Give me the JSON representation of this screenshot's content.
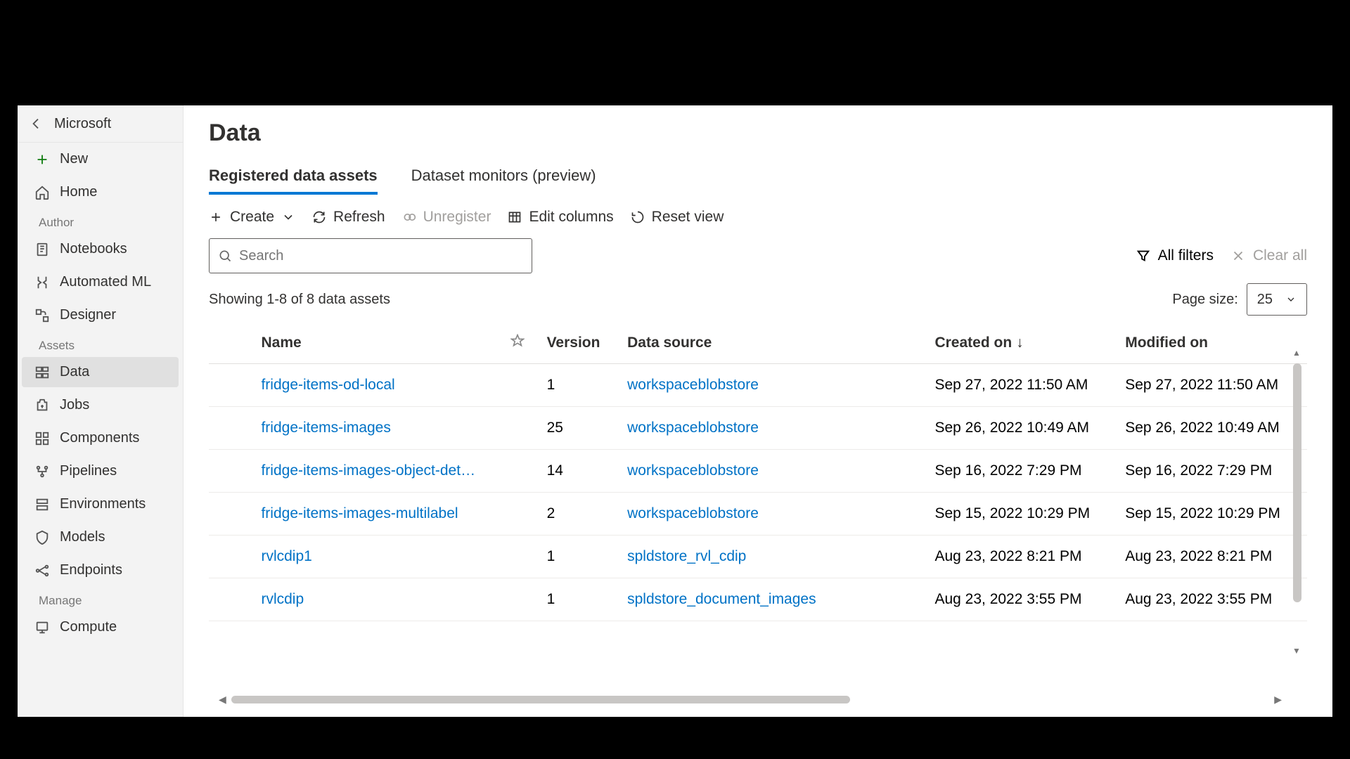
{
  "header": {
    "title": "Microsoft"
  },
  "sidebar": {
    "new_label": "New",
    "home_label": "Home",
    "groups": {
      "author": "Author",
      "assets": "Assets",
      "manage": "Manage"
    },
    "author_items": {
      "notebooks": "Notebooks",
      "automated_ml": "Automated ML",
      "designer": "Designer"
    },
    "assets_items": {
      "data": "Data",
      "jobs": "Jobs",
      "components": "Components",
      "pipelines": "Pipelines",
      "environments": "Environments",
      "models": "Models",
      "endpoints": "Endpoints"
    },
    "manage_items": {
      "compute": "Compute"
    }
  },
  "page": {
    "title": "Data",
    "tabs": {
      "registered": "Registered data assets",
      "monitors": "Dataset monitors (preview)"
    },
    "toolbar": {
      "create": "Create",
      "refresh": "Refresh",
      "unregister": "Unregister",
      "edit_columns": "Edit columns",
      "reset_view": "Reset view"
    },
    "search_placeholder": "Search",
    "all_filters": "All filters",
    "clear_all": "Clear all",
    "result_count": "Showing 1-8 of 8 data assets",
    "page_size_label": "Page size:",
    "page_size_value": "25",
    "columns": {
      "name": "Name",
      "version": "Version",
      "source": "Data source",
      "created": "Created on",
      "modified": "Modified on"
    },
    "rows": [
      {
        "name": "fridge-items-od-local",
        "version": "1",
        "source": "workspaceblobstore",
        "created": "Sep 27, 2022 11:50 AM",
        "modified": "Sep 27, 2022 11:50 AM"
      },
      {
        "name": "fridge-items-images",
        "version": "25",
        "source": "workspaceblobstore",
        "created": "Sep 26, 2022 10:49 AM",
        "modified": "Sep 26, 2022 10:49 AM"
      },
      {
        "name": "fridge-items-images-object-det…",
        "version": "14",
        "source": "workspaceblobstore",
        "created": "Sep 16, 2022 7:29 PM",
        "modified": "Sep 16, 2022 7:29 PM"
      },
      {
        "name": "fridge-items-images-multilabel",
        "version": "2",
        "source": "workspaceblobstore",
        "created": "Sep 15, 2022 10:29 PM",
        "modified": "Sep 15, 2022 10:29 PM"
      },
      {
        "name": "rvlcdip1",
        "version": "1",
        "source": "spldstore_rvl_cdip",
        "created": "Aug 23, 2022 8:21 PM",
        "modified": "Aug 23, 2022 8:21 PM"
      },
      {
        "name": "rvlcdip",
        "version": "1",
        "source": "spldstore_document_images",
        "created": "Aug 23, 2022 3:55 PM",
        "modified": "Aug 23, 2022 3:55 PM"
      }
    ]
  }
}
